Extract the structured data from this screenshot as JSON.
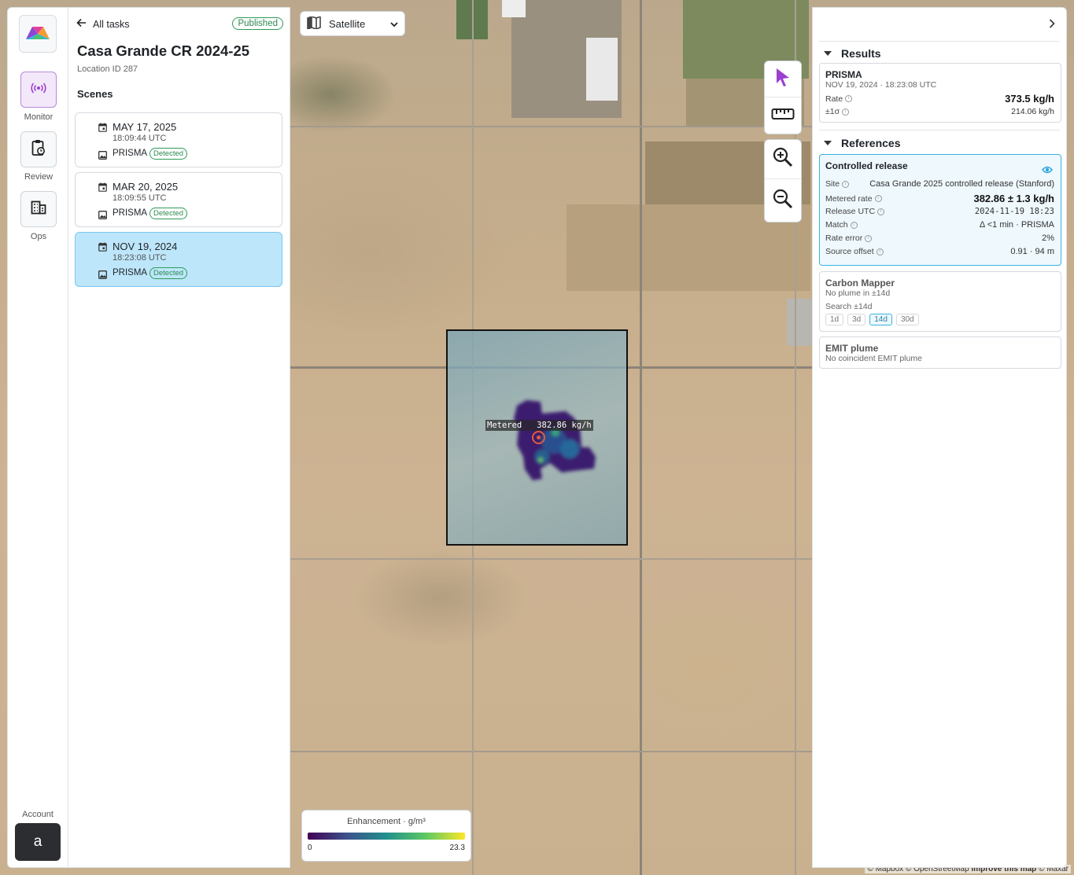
{
  "map": {
    "basemap_selected": "Satellite",
    "overlay_label": "Metered   382.86 kg/h",
    "legend": {
      "title": "Enhancement · g/m³",
      "min": "0",
      "max": "23.3"
    },
    "attribution_left": "© Mapbox © OpenStreetMap",
    "attribution_improve": "Improve this map",
    "attribution_right": "© Maxar"
  },
  "nav": {
    "monitor": "Monitor",
    "review": "Review",
    "ops": "Ops",
    "account": "Account",
    "avatar_letter": "a"
  },
  "task": {
    "back_label": "All tasks",
    "status": "Published",
    "title": "Casa Grande CR 2024-25",
    "location": "Location ID 287",
    "scenes_heading": "Scenes",
    "scenes": [
      {
        "date": "MAY 17, 2025",
        "time": "18:09:44 UTC",
        "sensor": "PRISMA",
        "badge": "Detected"
      },
      {
        "date": "MAR 20, 2025",
        "time": "18:09:55 UTC",
        "sensor": "PRISMA",
        "badge": "Detected"
      },
      {
        "date": "NOV 19, 2024",
        "time": "18:23:08 UTC",
        "sensor": "PRISMA",
        "badge": "Detected"
      }
    ]
  },
  "results": {
    "heading": "Results",
    "sensor": "PRISMA",
    "datetime": "NOV 19, 2024 · 18:23:08 UTC",
    "rate_label": "Rate",
    "rate_value": "373.5 kg/h",
    "sigma_label": "±1σ",
    "sigma_value": "214.06 kg/h"
  },
  "references": {
    "heading": "References",
    "controlled": {
      "title": "Controlled release",
      "site_label": "Site",
      "site_value": "Casa Grande 2025 controlled release (Stanford)",
      "metered_label": "Metered rate",
      "metered_value": "382.86 ± 1.3 kg/h",
      "release_label": "Release UTC",
      "release_value": "2024-11-19 18:23",
      "match_label": "Match",
      "match_value": "Δ <1 min · PRISMA",
      "rate_error_label": "Rate error",
      "rate_error_value": "2%",
      "offset_label": "Source offset",
      "offset_value": "0.91 · 94 m"
    },
    "carbon_mapper": {
      "title": "Carbon Mapper",
      "status": "No plume in ±14d",
      "search_label": "Search ±14d",
      "chips": [
        "1d",
        "3d",
        "14d",
        "30d"
      ]
    },
    "emit": {
      "title": "EMIT plume",
      "status": "No coincident EMIT plume"
    }
  },
  "colors": {
    "accent_purple": "#9b3fd0",
    "selected_scene": "#bde6fb",
    "detected_green": "#2e9b57",
    "highlight_blue": "#36b4e0"
  },
  "icons": [
    "logo-icon",
    "broadcast-icon",
    "clipboard-clock-icon",
    "building-icon",
    "arrow-left-icon",
    "calendar-icon",
    "image-icon",
    "map-icon",
    "chevron-down-icon",
    "pointer-icon",
    "ruler-icon",
    "zoom-in-icon",
    "zoom-out-icon",
    "chevron-right-icon",
    "info-icon",
    "eye-icon",
    "caret-down-icon"
  ]
}
